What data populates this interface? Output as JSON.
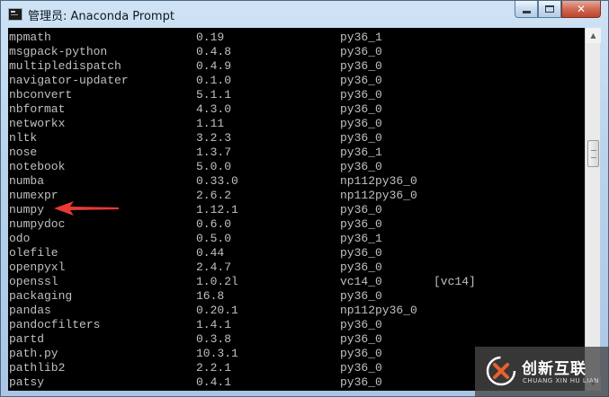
{
  "window": {
    "title": "管理员: Anaconda Prompt"
  },
  "colors": {
    "console_bg": "#000000",
    "console_text": "#c0c0c0",
    "arrow": "#e83a32",
    "close_button": "#c0432c"
  },
  "console": {
    "rows": [
      {
        "name": "mpmath",
        "version": "0.19",
        "build": "py36_1",
        "extra": ""
      },
      {
        "name": "msgpack-python",
        "version": "0.4.8",
        "build": "py36_0",
        "extra": ""
      },
      {
        "name": "multipledispatch",
        "version": "0.4.9",
        "build": "py36_0",
        "extra": ""
      },
      {
        "name": "navigator-updater",
        "version": "0.1.0",
        "build": "py36_0",
        "extra": ""
      },
      {
        "name": "nbconvert",
        "version": "5.1.1",
        "build": "py36_0",
        "extra": ""
      },
      {
        "name": "nbformat",
        "version": "4.3.0",
        "build": "py36_0",
        "extra": ""
      },
      {
        "name": "networkx",
        "version": "1.11",
        "build": "py36_0",
        "extra": ""
      },
      {
        "name": "nltk",
        "version": "3.2.3",
        "build": "py36_0",
        "extra": ""
      },
      {
        "name": "nose",
        "version": "1.3.7",
        "build": "py36_1",
        "extra": ""
      },
      {
        "name": "notebook",
        "version": "5.0.0",
        "build": "py36_0",
        "extra": ""
      },
      {
        "name": "numba",
        "version": "0.33.0",
        "build": "np112py36_0",
        "extra": ""
      },
      {
        "name": "numexpr",
        "version": "2.6.2",
        "build": "np112py36_0",
        "extra": ""
      },
      {
        "name": "numpy",
        "version": "1.12.1",
        "build": "py36_0",
        "extra": ""
      },
      {
        "name": "numpydoc",
        "version": "0.6.0",
        "build": "py36_0",
        "extra": ""
      },
      {
        "name": "odo",
        "version": "0.5.0",
        "build": "py36_1",
        "extra": ""
      },
      {
        "name": "olefile",
        "version": "0.44",
        "build": "py36_0",
        "extra": ""
      },
      {
        "name": "openpyxl",
        "version": "2.4.7",
        "build": "py36_0",
        "extra": ""
      },
      {
        "name": "openssl",
        "version": "1.0.2l",
        "build": "vc14_0",
        "extra": "[vc14]"
      },
      {
        "name": "packaging",
        "version": "16.8",
        "build": "py36_0",
        "extra": ""
      },
      {
        "name": "pandas",
        "version": "0.20.1",
        "build": "np112py36_0",
        "extra": ""
      },
      {
        "name": "pandocfilters",
        "version": "1.4.1",
        "build": "py36_0",
        "extra": ""
      },
      {
        "name": "partd",
        "version": "0.3.8",
        "build": "py36_0",
        "extra": ""
      },
      {
        "name": "path.py",
        "version": "10.3.1",
        "build": "py36_0",
        "extra": ""
      },
      {
        "name": "pathlib2",
        "version": "2.2.1",
        "build": "py36_0",
        "extra": ""
      },
      {
        "name": "patsy",
        "version": "0.4.1",
        "build": "py36_0",
        "extra": ""
      }
    ]
  },
  "annotation": {
    "icon": "red-arrow-icon",
    "points_to": "numpy"
  },
  "watermark": {
    "brand_cn": "创新互联",
    "brand_en": "CHUANG XIN HU LIAN"
  }
}
